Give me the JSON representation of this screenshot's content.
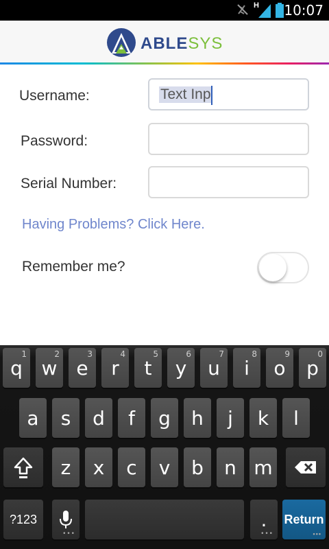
{
  "status_bar": {
    "time": "10:07",
    "network_type": "H",
    "icons": [
      "mute-icon",
      "signal-icon",
      "battery-icon"
    ]
  },
  "header": {
    "logo_text_part1": "ABLE",
    "logo_text_part2": "SYS",
    "colors": {
      "brand_blue": "#2f4a8c",
      "brand_green": "#7cbf3c"
    }
  },
  "form": {
    "username_label": "Username:",
    "username_value": "Text Inp",
    "password_label": "Password:",
    "password_value": "",
    "serial_label": "Serial Number:",
    "serial_value": "",
    "help_link": "Having Problems? Click Here.",
    "remember_label": "Remember me?",
    "remember_on": false
  },
  "keyboard": {
    "row1": [
      {
        "key": "q",
        "hint": "1"
      },
      {
        "key": "w",
        "hint": "2"
      },
      {
        "key": "e",
        "hint": "3"
      },
      {
        "key": "r",
        "hint": "4"
      },
      {
        "key": "t",
        "hint": "5"
      },
      {
        "key": "y",
        "hint": "6"
      },
      {
        "key": "u",
        "hint": "7"
      },
      {
        "key": "i",
        "hint": "8"
      },
      {
        "key": "o",
        "hint": "9"
      },
      {
        "key": "p",
        "hint": "0"
      }
    ],
    "row2": [
      "a",
      "s",
      "d",
      "f",
      "g",
      "h",
      "j",
      "k",
      "l"
    ],
    "row3": [
      "z",
      "x",
      "c",
      "v",
      "b",
      "n",
      "m"
    ],
    "symbols_label": "?123",
    "period_label": ".",
    "return_label": "Return"
  }
}
